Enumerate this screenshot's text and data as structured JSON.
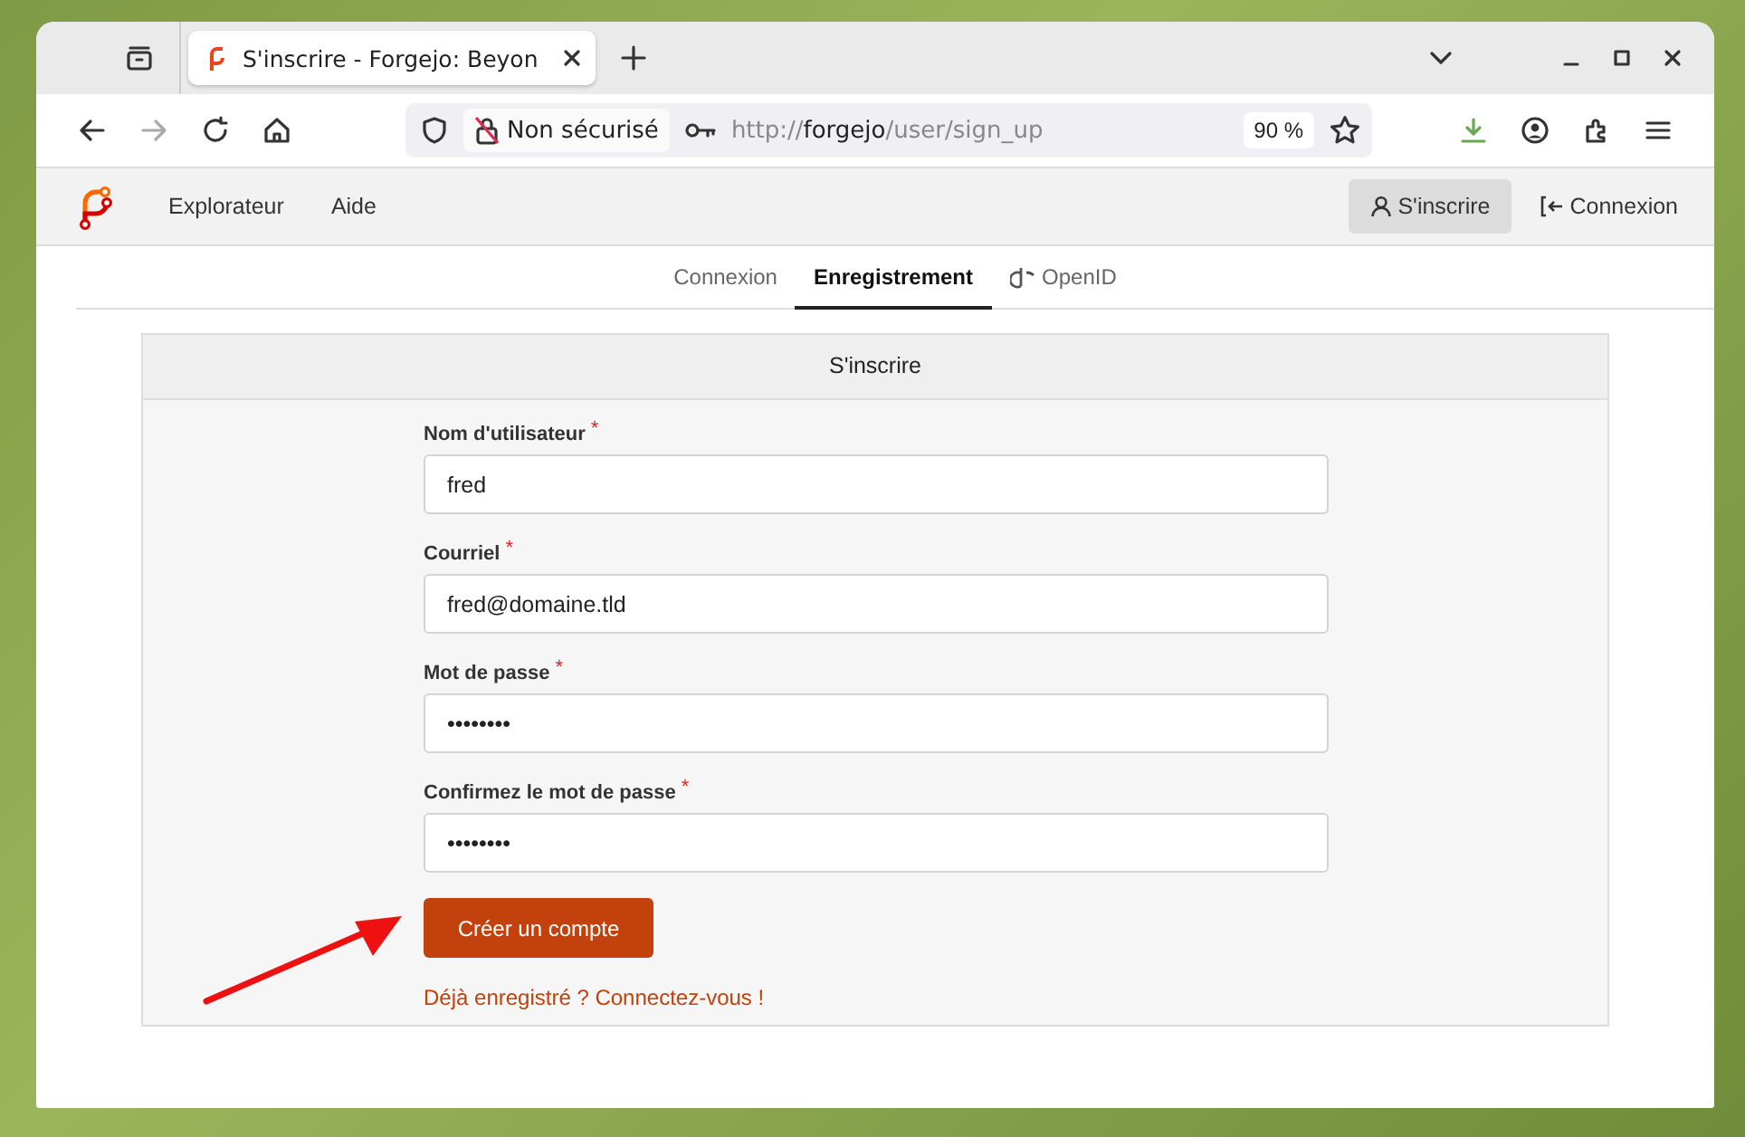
{
  "browser": {
    "tab_title": "S'inscrire - Forgejo: Beyon",
    "url_security": "Non sécurisé",
    "url": "http://**forgejo**/user/sign_up",
    "zoom": "90 %"
  },
  "nav": {
    "items": [
      {
        "label": "Explorateur"
      },
      {
        "label": "Aide"
      }
    ],
    "actions": [
      {
        "label": "S'inscrire",
        "kind": "signup",
        "selected": true
      },
      {
        "label": "Connexion",
        "kind": "signin",
        "selected": false
      }
    ]
  },
  "tabs": [
    {
      "label": "Connexion",
      "kind": "plain",
      "selected": false
    },
    {
      "label": "Enregistrement",
      "kind": "plain",
      "selected": true
    },
    {
      "label": "OpenID",
      "kind": "openid",
      "selected": false
    }
  ],
  "card": {
    "title": "S'inscrire",
    "fields": [
      {
        "label": "Nom d'utilisateur",
        "required_mark": "*",
        "value": "fred"
      },
      {
        "label": "Courriel",
        "required_mark": "*",
        "value": "fred@domaine.tld"
      },
      {
        "label": "Mot de passe",
        "required_mark": "*",
        "value": "••••••••"
      },
      {
        "label": "Confirmez le mot de passe",
        "required_mark": "*",
        "value": "••••••••"
      }
    ],
    "submit": "Créer un compte",
    "signin_link": "Déjà enregistré ? Connectez-vous !"
  }
}
